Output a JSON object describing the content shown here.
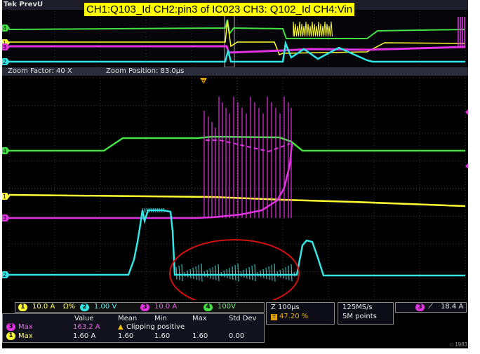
{
  "app": {
    "brand": "Tek PrevU"
  },
  "title": "CH1:Q103_Id CH2:pin3 of IC023 CH3: Q102_Id CH4:Vin",
  "zoom": {
    "factor": "Zoom Factor: 40 X",
    "position": "Zoom Position: 83.0µs"
  },
  "colors": {
    "ch1": "#ffff33",
    "ch2": "#33e6e6",
    "ch3": "#e133e1",
    "ch4": "#44e044",
    "annotation": "#d01010"
  },
  "channels": [
    {
      "id": "1",
      "scale": "10.0 A",
      "extra": "Ω%",
      "color": "#ffff33"
    },
    {
      "id": "2",
      "scale": "1.00 V",
      "color": "#33e6e6"
    },
    {
      "id": "3",
      "scale": "10.0 A",
      "color": "#e133e1"
    },
    {
      "id": "4",
      "scale": "100V",
      "color": "#44e044"
    }
  ],
  "timebase": {
    "scale": "Z 100µs",
    "trigger_pos": "47.20 %"
  },
  "acquisition": {
    "rate": "125MS/s",
    "points": "5M points"
  },
  "trigger": {
    "channel": "3",
    "slope_icon": "rising-edge-icon",
    "level": "18.4 A"
  },
  "measurements": {
    "headers": [
      "Value",
      "Mean",
      "Min",
      "Max",
      "Std Dev"
    ],
    "rows": [
      {
        "channel": "3",
        "name": "Max",
        "value": "163.2 A",
        "warning": "Clipping positive"
      },
      {
        "channel": "1",
        "name": "Max",
        "value": "1.60 A",
        "mean": "1.60",
        "min": "1.60",
        "max": "1.60",
        "std": "0.00"
      }
    ]
  },
  "markers": {
    "ch4": "4",
    "ch1": "1",
    "ch3": "3",
    "ch2": "2",
    "trig": "T"
  },
  "watermark": "□ 1983"
}
